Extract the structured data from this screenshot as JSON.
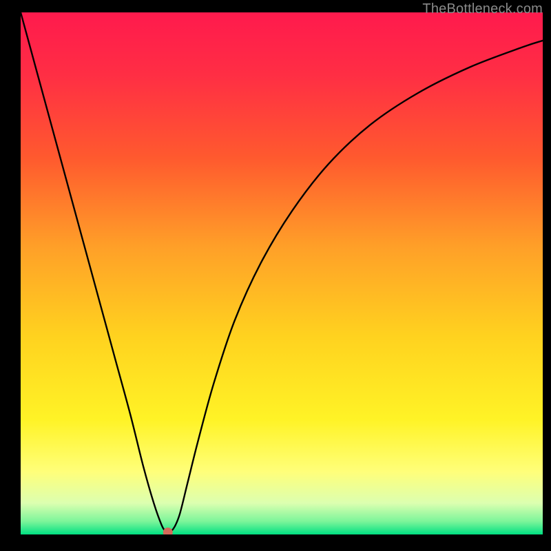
{
  "watermark": "TheBottleneck.com",
  "chart_data": {
    "type": "line",
    "title": "",
    "xlabel": "",
    "ylabel": "",
    "xlim": [
      0,
      100
    ],
    "ylim": [
      0,
      100
    ],
    "background_gradient": {
      "stops": [
        {
          "offset": 0.0,
          "color": "#ff1a4d"
        },
        {
          "offset": 0.12,
          "color": "#ff2e44"
        },
        {
          "offset": 0.28,
          "color": "#ff5a2e"
        },
        {
          "offset": 0.45,
          "color": "#ffa028"
        },
        {
          "offset": 0.62,
          "color": "#ffd21f"
        },
        {
          "offset": 0.78,
          "color": "#fff326"
        },
        {
          "offset": 0.88,
          "color": "#ffff7a"
        },
        {
          "offset": 0.94,
          "color": "#dcffb0"
        },
        {
          "offset": 0.975,
          "color": "#7cf59a"
        },
        {
          "offset": 1.0,
          "color": "#00e082"
        }
      ]
    },
    "series": [
      {
        "name": "bottleneck-curve",
        "x": [
          0,
          3,
          6,
          9,
          12,
          15,
          18,
          21,
          23.5,
          25.5,
          27.0,
          27.8,
          28.2,
          28.7,
          29.5,
          30.5,
          32,
          34,
          37,
          41,
          46,
          52,
          59,
          67,
          76,
          86,
          96,
          100
        ],
        "values": [
          100,
          89,
          78,
          67,
          56,
          45,
          34,
          23,
          13,
          6,
          1.8,
          0.5,
          0.2,
          0.5,
          1.5,
          4,
          10,
          18,
          29,
          41,
          52,
          62,
          71,
          78.5,
          84.5,
          89.5,
          93.3,
          94.6
        ]
      }
    ],
    "marker": {
      "x": 28.2,
      "y": 0.4,
      "color": "#d46a5a",
      "r": 7
    }
  }
}
